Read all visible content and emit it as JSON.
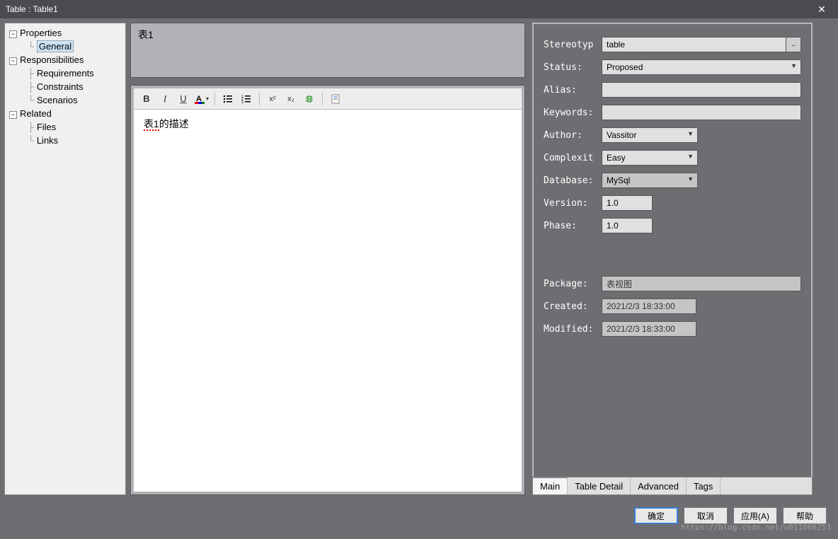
{
  "window": {
    "title": "Table : Table1"
  },
  "tree": {
    "properties": "Properties",
    "general": "General",
    "responsibilities": "Responsibilities",
    "requirements": "Requirements",
    "constraints": "Constraints",
    "scenarios": "Scenarios",
    "related": "Related",
    "files": "Files",
    "links": "Links"
  },
  "name_field": "表1",
  "description": {
    "pre": "表1",
    "post": "的描述"
  },
  "toolbar": {
    "bold": "B",
    "italic": "I",
    "underline": "U"
  },
  "props": {
    "stereotype": {
      "label": "Stereotyp",
      "value": "table"
    },
    "status": {
      "label": "Status:",
      "value": "Proposed"
    },
    "alias": {
      "label": "Alias:",
      "value": ""
    },
    "keywords": {
      "label": "Keywords:",
      "value": ""
    },
    "author": {
      "label": "Author:",
      "value": "Vassitor"
    },
    "complexity": {
      "label": "Complexit",
      "value": "Easy"
    },
    "database": {
      "label": "Database:",
      "value": "MySql"
    },
    "version": {
      "label": "Version:",
      "value": "1.0"
    },
    "phase": {
      "label": "Phase:",
      "value": "1.0"
    },
    "package": {
      "label": "Package:",
      "value": "表视图"
    },
    "created": {
      "label": "Created:",
      "value": "2021/2/3 18:33:00"
    },
    "modified": {
      "label": "Modified:",
      "value": "2021/2/3 18:33:00"
    }
  },
  "tabs": {
    "main": "Main",
    "detail": "Table Detail",
    "advanced": "Advanced",
    "tags": "Tags"
  },
  "buttons": {
    "ok": "确定",
    "cancel": "取消",
    "apply": "应用(A)",
    "help": "帮助"
  },
  "watermark": "https://blog.csdn.net/u011066253"
}
